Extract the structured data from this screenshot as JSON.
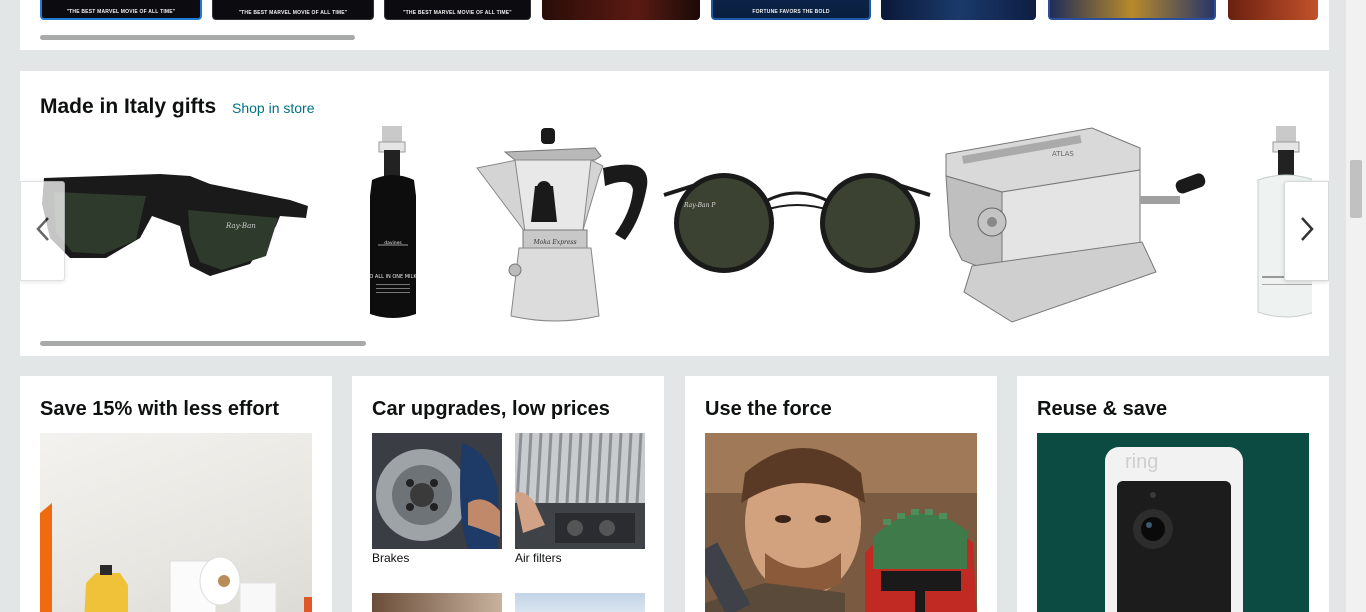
{
  "top_carousel": {
    "movies": [
      {
        "caption": "\"THE BEST MARVEL MOVIE OF ALL TIME\""
      },
      {
        "caption": "\"THE BEST MARVEL MOVIE OF ALL TIME\""
      },
      {
        "caption": "\"THE BEST MARVEL MOVIE OF ALL TIME\""
      },
      {
        "caption": ""
      },
      {
        "caption": "FORTUNE FAVORS THE BOLD"
      },
      {
        "caption": ""
      },
      {
        "caption": ""
      },
      {
        "caption": ""
      }
    ]
  },
  "italy": {
    "title": "Made in Italy gifts",
    "link": "Shop in store",
    "products": [
      {
        "icon": "sunglasses-wayfarer-image"
      },
      {
        "icon": "hair-milk-bottle-image",
        "label": "O ALL IN ONE MILK"
      },
      {
        "icon": "moka-pot-image"
      },
      {
        "icon": "round-sunglasses-image"
      },
      {
        "icon": "pasta-machine-image"
      },
      {
        "icon": "spray-bottle-image"
      }
    ],
    "prev_icon": "chevron-left-icon",
    "next_icon": "chevron-right-icon"
  },
  "cards": [
    {
      "title": "Save 15% with less effort"
    },
    {
      "title": "Car upgrades, low prices",
      "tiles": [
        {
          "label": "Brakes"
        },
        {
          "label": "Air filters"
        }
      ]
    },
    {
      "title": "Use the force"
    },
    {
      "title": "Reuse & save",
      "brand": "ring"
    }
  ],
  "colors": {
    "background": "#e3e6e6",
    "link": "#007185",
    "card": "#ffffff"
  }
}
